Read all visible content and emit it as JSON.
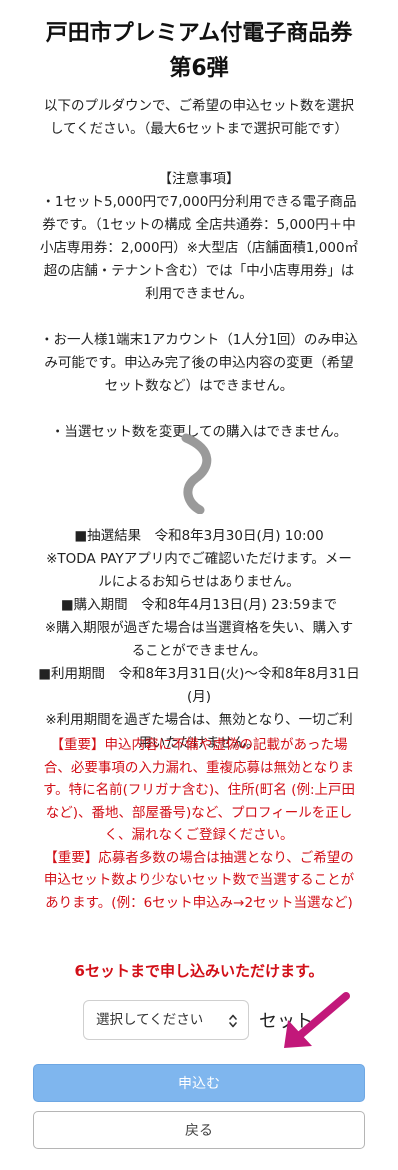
{
  "header": {
    "title_line1": "戸田市プレミアム付電子商品券",
    "title_line2": "第6弾"
  },
  "intro": {
    "line1": "以下のプルダウンで、ご希望の申込セット数を選択",
    "line2": "してください。（最大6セットまで選択可能です）"
  },
  "caution": {
    "heading": "【注意事項】",
    "p1": [
      "・1セット5,000円で7,000円分利用できる電子商品",
      "券です。（1セットの構成 全店共通券：5,000円＋中",
      "小店専用券：2,000円）※大型店（店舗面積1,000㎡",
      "超の店舗・テナント含む）では「中小店専用券」は",
      "利用できません。"
    ],
    "p2": [
      "・お一人様1端末1アカウント（1人分1回）のみ申込",
      "み可能です。申込み完了後の申込内容の変更（希望",
      "セット数など）はできません。"
    ],
    "p3": "・当選セット数を変更しての購入はできません。"
  },
  "schedule": [
    "■抽選結果　令和8年3月30日(月) 10:00",
    "※TODA PAYアプリ内でご確認いただけます。メー",
    "ルによるお知らせはありません。",
    "■購入期間　令和8年4月13日(月) 23:59まで",
    "※購入期限が過ぎた場合は当選資格を失い、購入す",
    "ることができません。",
    "■利用期間　令和8年3月31日(火)〜令和8年8月31日",
    "(月)",
    "※利用期間を過ぎた場合は、無効となり、一切ご利",
    "用いただけません。"
  ],
  "important": [
    "【重要】申込内容に不備や虚偽の記載があった場",
    "合、必要事項の入力漏れ、重複応募は無効となりま",
    "す。特に名前(フリガナ含む)、住所(町名 (例:上戸田",
    "など)、番地、部屋番号)など、プロフィールを正し",
    "く、漏れなくご登録ください。",
    "【重要】応募者多数の場合は抽選となり、ご希望の",
    "申込セット数より少ないセット数で当選することが",
    "あります。(例：6セット申込み→2セット当選など)"
  ],
  "notice": "6セットまで申し込みいただけます。",
  "form": {
    "select_value": "選択してください",
    "unit_label": "セット"
  },
  "buttons": {
    "submit": "申込む",
    "back": "戻る"
  },
  "colors": {
    "important_red": "#d20f17",
    "submit_blue": "#7fb6ee",
    "arrow_magenta": "#c2187a"
  }
}
